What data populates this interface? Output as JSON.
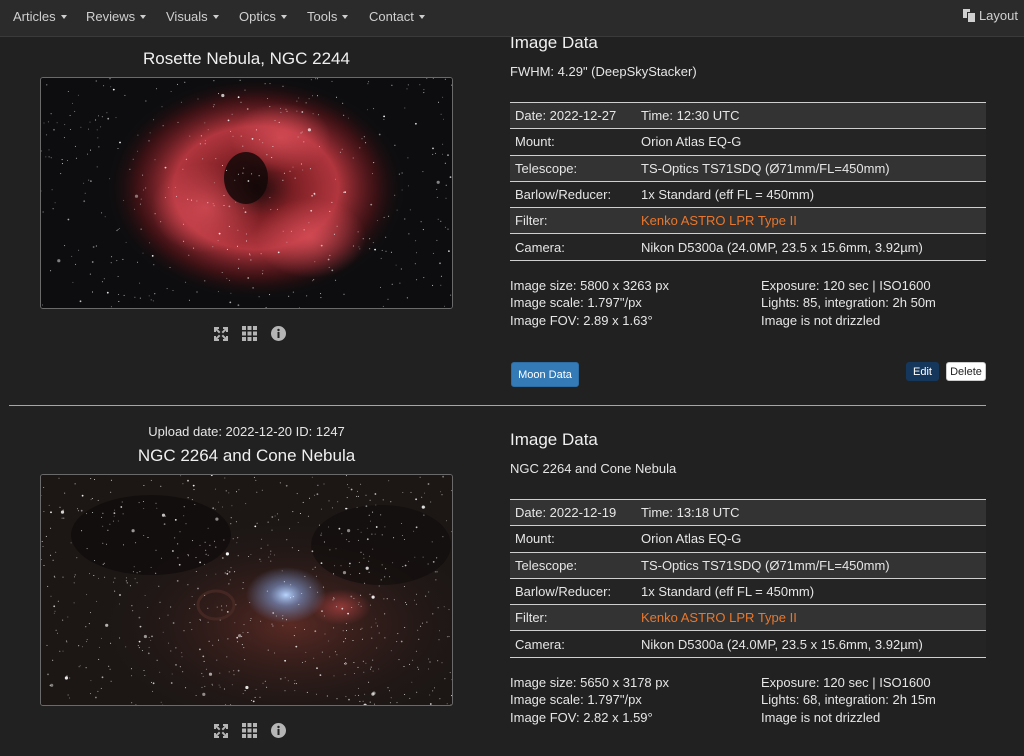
{
  "nav": {
    "items": [
      "Articles",
      "Reviews",
      "Visuals",
      "Optics",
      "Tools",
      "Contact"
    ],
    "layout_label": "Layout"
  },
  "entries": [
    {
      "upload_line": "",
      "object_title": "Rosette Nebula, NGC 2244",
      "panel_title": "Image Data",
      "panel_sub": "FWHM: 4.29\" (DeepSkyStacker)",
      "rows": [
        {
          "k": "Date: 2022-12-27",
          "v": "Time: 12:30 UTC"
        },
        {
          "k": "Mount:",
          "v": "Orion Atlas EQ-G"
        },
        {
          "k": "Telescope:",
          "v": "TS-Optics TS71SDQ (Ø71mm/FL=450mm)"
        },
        {
          "k": "Barlow/Reducer:",
          "v": "1x Standard (eff FL = 450mm)"
        },
        {
          "k": "Filter:",
          "v": "Kenko ASTRO LPR Type II"
        },
        {
          "k": "Camera:",
          "v": "Nikon D5300a (24.0MP, 23.5 x 15.6mm, 3.92µm)"
        }
      ],
      "stats_left": [
        "Image size: 5800 x 3263 px",
        "Image scale: 1.797\"/px",
        "Image FOV: 2.89 x 1.63°"
      ],
      "stats_right": [
        "Exposure: 120 sec | ISO1600",
        "Lights: 85, integration: 2h 50m",
        "Image is not drizzled"
      ],
      "moon_label": "Moon Data",
      "edit_label": "Edit",
      "delete_label": "Delete"
    },
    {
      "upload_line": "Upload date: 2022-12-20 ID: 1247",
      "object_title": "NGC 2264 and Cone Nebula",
      "panel_title": "Image Data",
      "panel_sub": "NGC 2264 and Cone Nebula",
      "rows": [
        {
          "k": "Date: 2022-12-19",
          "v": "Time: 13:18 UTC"
        },
        {
          "k": "Mount:",
          "v": "Orion Atlas EQ-G"
        },
        {
          "k": "Telescope:",
          "v": "TS-Optics TS71SDQ (Ø71mm/FL=450mm)"
        },
        {
          "k": "Barlow/Reducer:",
          "v": "1x Standard (eff FL = 450mm)"
        },
        {
          "k": "Filter:",
          "v": "Kenko ASTRO LPR Type II"
        },
        {
          "k": "Camera:",
          "v": "Nikon D5300a (24.0MP, 23.5 x 15.6mm, 3.92µm)"
        }
      ],
      "stats_left": [
        "Image size: 5650 x 3178 px",
        "Image scale: 1.797\"/px",
        "Image FOV: 2.82 x 1.59°"
      ],
      "stats_right": [
        "Exposure: 120 sec | ISO1600",
        "Lights: 68, integration: 2h 15m",
        "Image is not drizzled"
      ]
    }
  ],
  "colors": {
    "accent": "#337ab7",
    "filter_link": "#e8772d",
    "background": "#212121"
  },
  "icons": [
    "fullscreen-icon",
    "grid-icon",
    "info-icon"
  ]
}
